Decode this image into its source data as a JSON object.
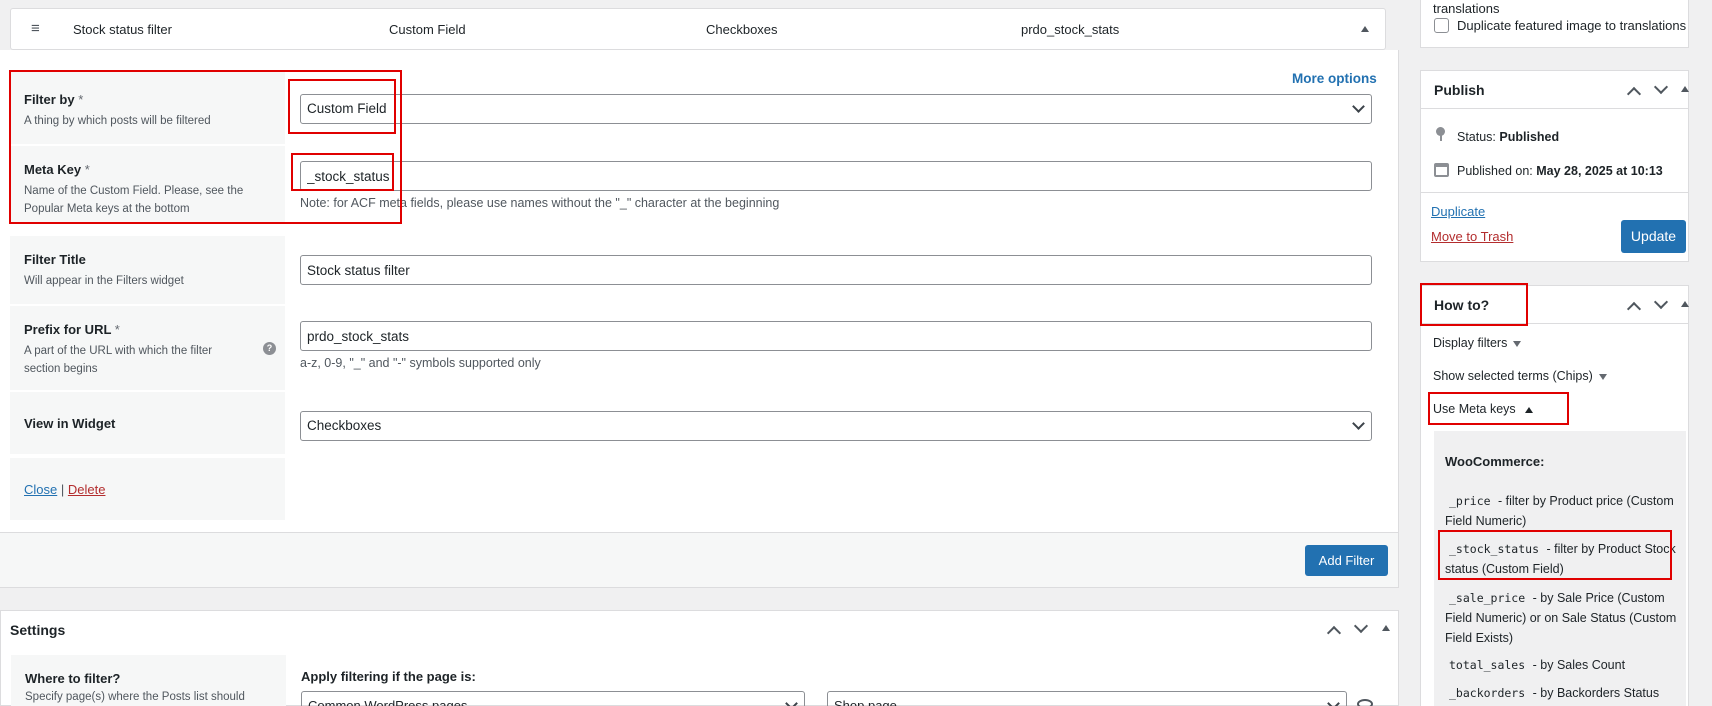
{
  "filter_header": {
    "title": "Stock status filter",
    "type": "Custom Field",
    "view": "Checkboxes",
    "prefix": "prdo_stock_stats"
  },
  "more_options": "More options",
  "rows": {
    "filter_by": {
      "title": "Filter by",
      "required": "*",
      "desc": "A thing by which posts will be filtered",
      "value": "Custom Field"
    },
    "meta_key": {
      "title": "Meta Key",
      "required": "*",
      "desc": "Name of the Custom Field. Please, see the Popular Meta keys at the bottom",
      "value": "_stock_status",
      "note": "Note: for ACF meta fields, please use names without the \"_\" character at the beginning"
    },
    "filter_title": {
      "title": "Filter Title",
      "desc": "Will appear in the Filters widget",
      "value": "Stock status filter"
    },
    "prefix": {
      "title": "Prefix for URL",
      "required": "*",
      "desc": "A part of the URL with which the filter section begins",
      "value": "prdo_stock_stats",
      "note": "a-z, 0-9, \"_\" and \"-\" symbols supported only"
    },
    "view": {
      "title": "View in Widget",
      "value": "Checkboxes"
    }
  },
  "links": {
    "close": "Close",
    "separator": "|",
    "delete": "Delete"
  },
  "add_filter_button": "Add Filter",
  "settings": {
    "title": "Settings",
    "where_title": "Where to filter?",
    "where_desc": "Specify page(s) where the Posts list should",
    "apply_label": "Apply filtering if the page is:",
    "select1": "Common WordPress pages",
    "select2": "Shop page"
  },
  "sidebar": {
    "translations_text": "translations",
    "duplicate_image": "Duplicate featured image to translations",
    "publish": {
      "title": "Publish",
      "status_label": "Status:",
      "status_value": "Published",
      "published_label": "Published on:",
      "published_value": "May 28, 2025 at 10:13",
      "duplicate": "Duplicate",
      "trash": "Move to Trash",
      "update": "Update"
    },
    "howto": {
      "title": "How to?",
      "display_filters": "Display filters",
      "chips": "Show selected terms (Chips)",
      "meta_keys": "Use Meta keys",
      "woocommerce": "WooCommerce:",
      "items": [
        {
          "code": "_price",
          "text": " - filter by Product price (Custom Field Numeric)"
        },
        {
          "code": "_stock_status",
          "text": " - filter by Product Stock status (Custom Field)"
        },
        {
          "code": "_sale_price",
          "text": " - by Sale Price (Custom Field Numeric) or on Sale Status (Custom Field Exists)"
        },
        {
          "code": "total_sales",
          "text": " - by Sales Count"
        },
        {
          "code": "_backorders",
          "text": " - by Backorders Status"
        }
      ]
    }
  },
  "colors": {
    "accent": "#2271b1",
    "highlight": "#e00000",
    "danger": "#b32d2e"
  }
}
